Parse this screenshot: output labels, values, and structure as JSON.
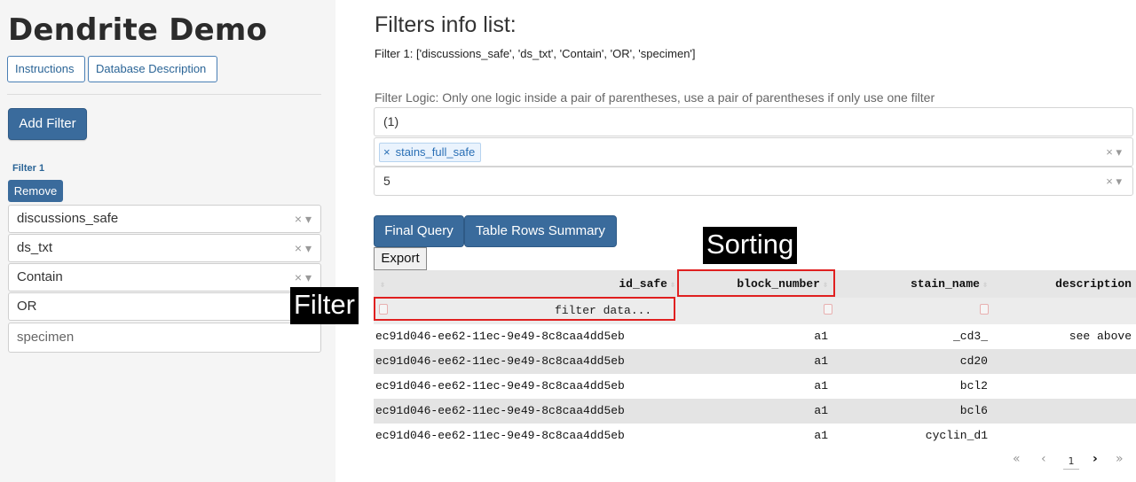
{
  "sidebar": {
    "app_title": "Dendrite Demo",
    "nav": {
      "instructions": "Instructions",
      "database_description": "Database Description"
    },
    "add_filter": "Add Filter",
    "filter_label": "Filter 1",
    "remove": "Remove",
    "fields": {
      "column": "discussions_safe",
      "table": "ds_txt",
      "operator": "Contain",
      "logic": "OR",
      "value_placeholder": "specimen"
    }
  },
  "main": {
    "title": "Filters info list:",
    "filter_summary": "Filter 1: ['discussions_safe', 'ds_txt', 'Contain', 'OR', 'specimen']",
    "logic_label": "Filter Logic: Only one logic inside a pair of parentheses, use a pair of parentheses if only use one filter",
    "logic_value": "(1)",
    "column_tag": "stains_full_safe",
    "rows_value": "5",
    "buttons": {
      "final_query": "Final Query",
      "table_rows_summary": "Table Rows Summary",
      "export": "Export"
    }
  },
  "annotations": {
    "sorting": "Sorting",
    "filter": "Filter"
  },
  "table": {
    "columns": [
      "id_safe",
      "block_number",
      "stain_name",
      "description"
    ],
    "filter_placeholder": "filter data...",
    "rows": [
      [
        "ec91d046-ee62-11ec-9e49-8c8caa4dd5eb",
        "a1",
        "_cd3_",
        "see above"
      ],
      [
        "ec91d046-ee62-11ec-9e49-8c8caa4dd5eb",
        "a1",
        "cd20",
        ""
      ],
      [
        "ec91d046-ee62-11ec-9e49-8c8caa4dd5eb",
        "a1",
        "bcl2",
        ""
      ],
      [
        "ec91d046-ee62-11ec-9e49-8c8caa4dd5eb",
        "a1",
        "bcl6",
        ""
      ],
      [
        "ec91d046-ee62-11ec-9e49-8c8caa4dd5eb",
        "a1",
        "cyclin_d1",
        ""
      ]
    ]
  },
  "pagination": {
    "first": "«",
    "prev": "‹",
    "page": "1",
    "next": "›",
    "last": "»"
  },
  "icons": {
    "clear": "clear-icon",
    "dropdown": "dropdown-caret-icon",
    "sort": "sort-icon"
  },
  "colors": {
    "primary_button": "#3a6b9c",
    "highlight": "#e02020",
    "tag_bg": "#eaf3fd",
    "row_alt": "#e4e4e4"
  }
}
